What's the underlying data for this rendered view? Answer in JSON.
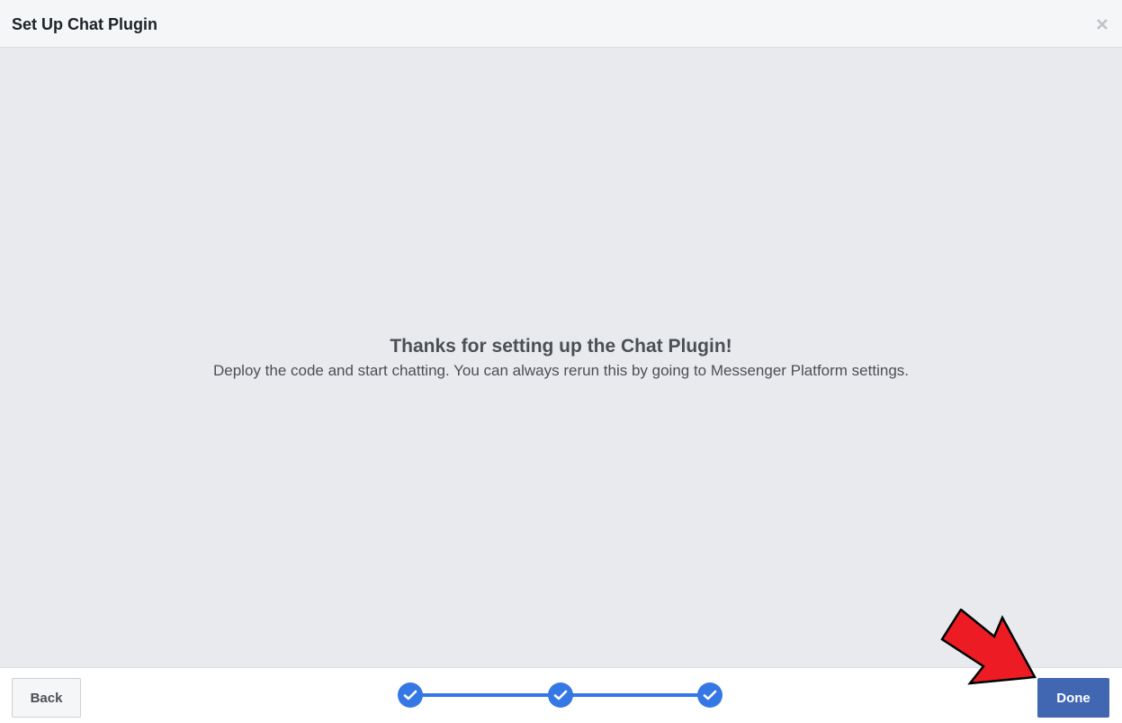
{
  "header": {
    "title": "Set Up Chat Plugin",
    "close_icon": "close-icon"
  },
  "body": {
    "heading": "Thanks for setting up the Chat Plugin!",
    "subtext": "Deploy the code and start chatting. You can always rerun this by going to Messenger Platform settings."
  },
  "footer": {
    "back_label": "Back",
    "done_label": "Done",
    "steps": [
      {
        "state": "complete",
        "icon": "check-icon"
      },
      {
        "state": "complete",
        "icon": "check-icon"
      },
      {
        "state": "complete",
        "icon": "check-icon"
      }
    ]
  },
  "colors": {
    "accent": "#4267b2",
    "step": "#3578e5",
    "header_bg": "#f5f6f7",
    "body_bg": "#e9eaed",
    "annotation_arrow": "#ed1c24"
  }
}
